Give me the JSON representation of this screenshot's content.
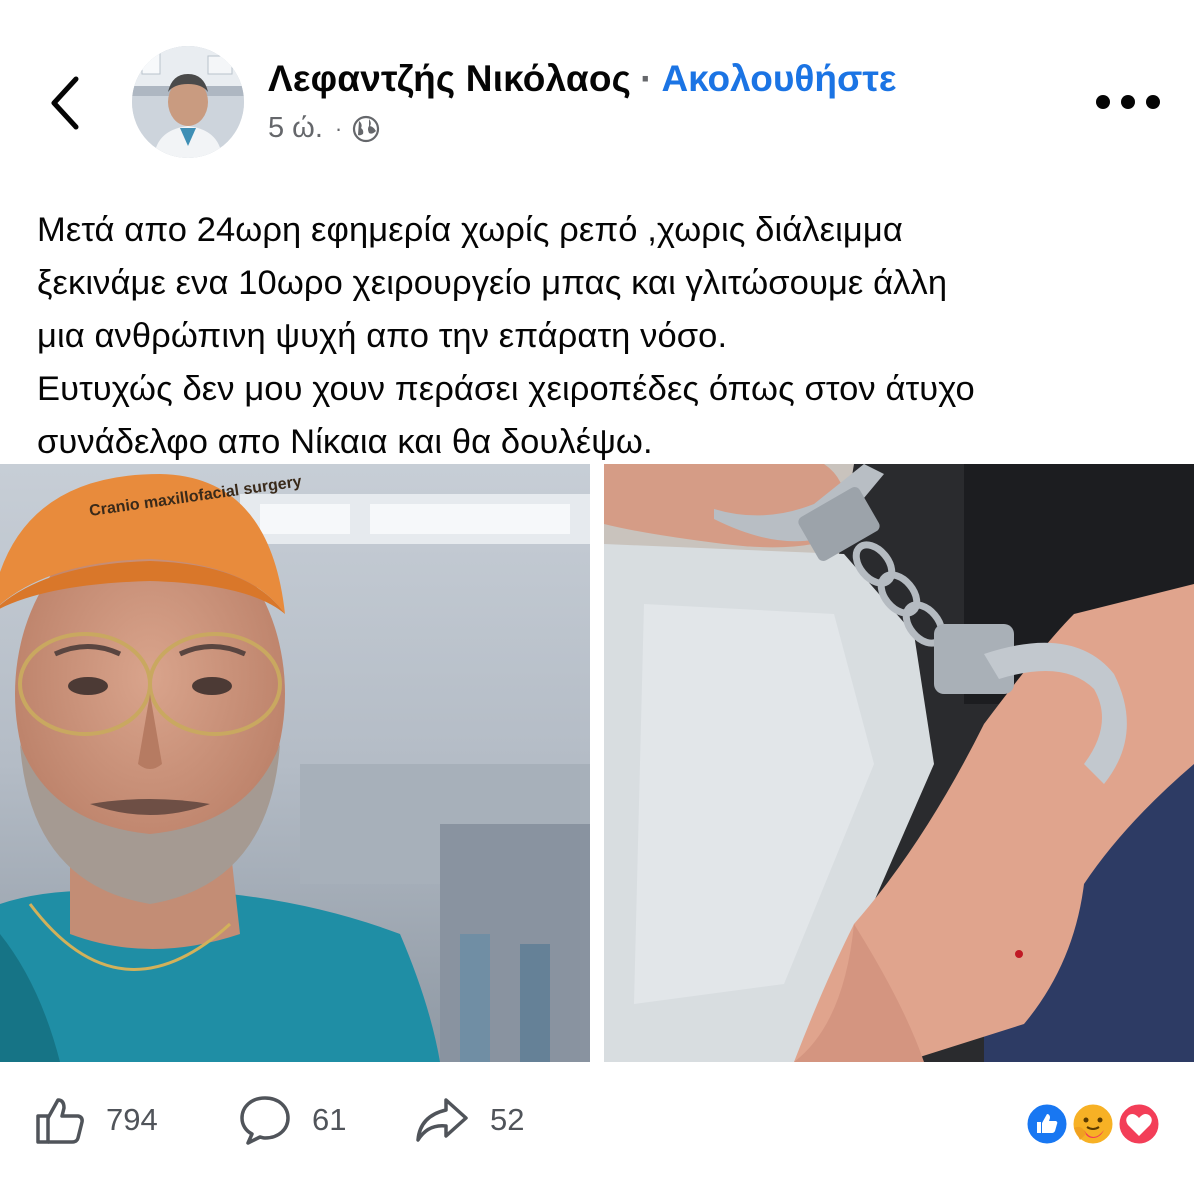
{
  "header": {
    "back_icon": "chevron-left-icon",
    "author_name": "Λεφαντζής Νικόλαος",
    "separator": "·",
    "follow_label": "Ακολουθήστε",
    "time": "5 ώ.",
    "meta_separator": "·",
    "audience_icon": "globe-icon",
    "more_icon": "more-horizontal-icon"
  },
  "post": {
    "lines": [
      "Μετά απο 24ωρη εφημερία χωρίς ρεπό ,χωρις διάλειμμα",
      "ξεκινάμε ενα 10ωρο χειρουργείο μπας και γλιτώσουμε άλλη",
      "μια ανθρώπινη ψυχή απο την επάρατη νόσο.",
      "Ευτυχώς δεν μου χουν περάσει χειροπέδες όπως στον άτυχο",
      "συνάδελφο απο Νίκαια και θα δουλέψω."
    ],
    "cap_lettering": "Cranio maxillofacial surgery"
  },
  "actions": {
    "like_icon": "thumbs-up-icon",
    "like_count": "794",
    "comment_icon": "comment-icon",
    "comment_count": "61",
    "share_icon": "share-arrow-icon",
    "share_count": "52",
    "reaction_icons": [
      "like-reaction-icon",
      "care-reaction-icon",
      "love-reaction-icon"
    ]
  },
  "colors": {
    "follow_blue": "#1b74e4",
    "like_blue": "#1877f2",
    "love_red": "#f33e58",
    "care_yellow": "#f7b125",
    "secondary_text": "#65676b"
  }
}
